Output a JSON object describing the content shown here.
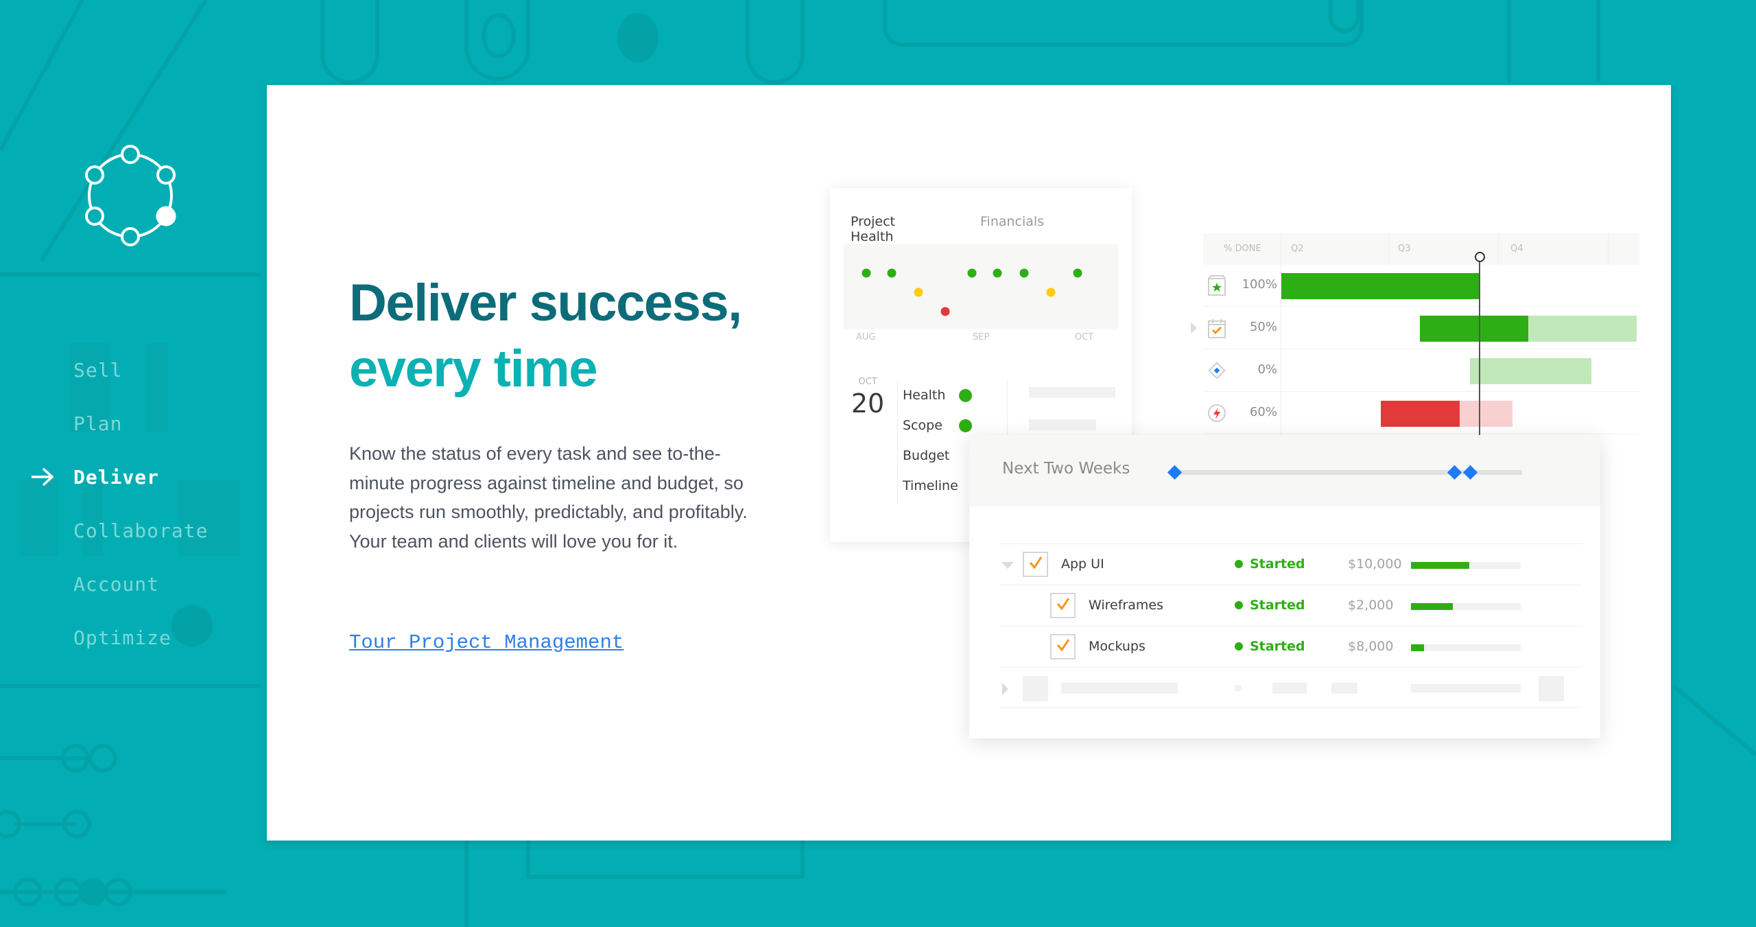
{
  "brand": {
    "background_color": "#02aeb3",
    "logo": "network-ring-logo-icon"
  },
  "nav": {
    "active_index": 2,
    "active_icon": "arrow-right-icon",
    "items": [
      {
        "label": "Sell"
      },
      {
        "label": "Plan"
      },
      {
        "label": "Deliver"
      },
      {
        "label": "Collaborate"
      },
      {
        "label": "Account"
      },
      {
        "label": "Optimize"
      }
    ]
  },
  "hero": {
    "headline_line1": "Deliver success,",
    "headline_line2": "every time",
    "headline_color1": "#0d6c79",
    "headline_color2": "#0bb1b3",
    "body": "Know the status of every task and see to-the-minute progress against timeline and budget, so projects run smoothly, predictably, and profitably. Your team and clients will love you for it.",
    "cta_label": "Tour Project Management",
    "cta_color": "#2f7fe6"
  },
  "health_card": {
    "tabs": [
      {
        "label": "Project Health",
        "active": true
      },
      {
        "label": "Financials",
        "active": false
      }
    ],
    "months": [
      "AUG",
      "SEP",
      "OCT"
    ],
    "health_dots": [
      {
        "status": "green"
      },
      {
        "status": "green"
      },
      {
        "status": "yellow"
      },
      {
        "status": "red"
      },
      {
        "status": "green"
      },
      {
        "status": "green"
      },
      {
        "status": "green"
      },
      {
        "status": "yellow"
      },
      {
        "status": "green"
      }
    ],
    "status_colors": {
      "green": "#2eae15",
      "yellow": "#fdcc0d",
      "red": "#e23a3a"
    },
    "date": {
      "month": "OCT",
      "day": "20"
    },
    "metrics": [
      {
        "label": "Health",
        "status": "green"
      },
      {
        "label": "Scope",
        "status": "green"
      },
      {
        "label": "Budget",
        "status": ""
      },
      {
        "label": "Timeline",
        "status": ""
      }
    ]
  },
  "gantt": {
    "header_label": "% DONE",
    "quarters": [
      "Q2",
      "Q3",
      "Q4"
    ],
    "today_position_quarters": 1.83,
    "rows": [
      {
        "icon": "calendar-star-icon",
        "percent_label": "100%",
        "start_q": 0.0,
        "end_q": 1.83,
        "done": 1.0,
        "color": "green",
        "expandable": false
      },
      {
        "icon": "calendar-check-icon",
        "percent_label": "50%",
        "start_q": 1.28,
        "end_q": 3.28,
        "done": 0.5,
        "color": "green",
        "expandable": true
      },
      {
        "icon": "milestone-diamond-icon",
        "percent_label": "0%",
        "start_q": 1.74,
        "end_q": 2.86,
        "done": 0.0,
        "color": "green",
        "expandable": false
      },
      {
        "icon": "lightning-alert-icon",
        "percent_label": "60%",
        "start_q": 0.92,
        "end_q": 2.13,
        "done": 0.6,
        "color": "red",
        "expandable": false
      }
    ],
    "bar_colors": {
      "green_done": "#2eae15",
      "green_todo": "#c1e8b8",
      "red_done": "#e23a3a",
      "red_todo": "#f8d0d0"
    }
  },
  "next_two_weeks": {
    "title": "Next Two Weeks",
    "milestones": [
      0.0,
      0.8,
      0.845
    ],
    "milestone_color": "#1d7bf5",
    "tasks": [
      {
        "name": "App UI",
        "status": "Started",
        "amount": "$10,000",
        "progress": 0.53,
        "checked": true,
        "level": 0,
        "expanded": true
      },
      {
        "name": "Wireframes",
        "status": "Started",
        "amount": "$2,000",
        "progress": 0.38,
        "checked": true,
        "level": 1
      },
      {
        "name": "Mockups",
        "status": "Started",
        "amount": "$8,000",
        "progress": 0.12,
        "checked": true,
        "level": 1
      }
    ]
  }
}
